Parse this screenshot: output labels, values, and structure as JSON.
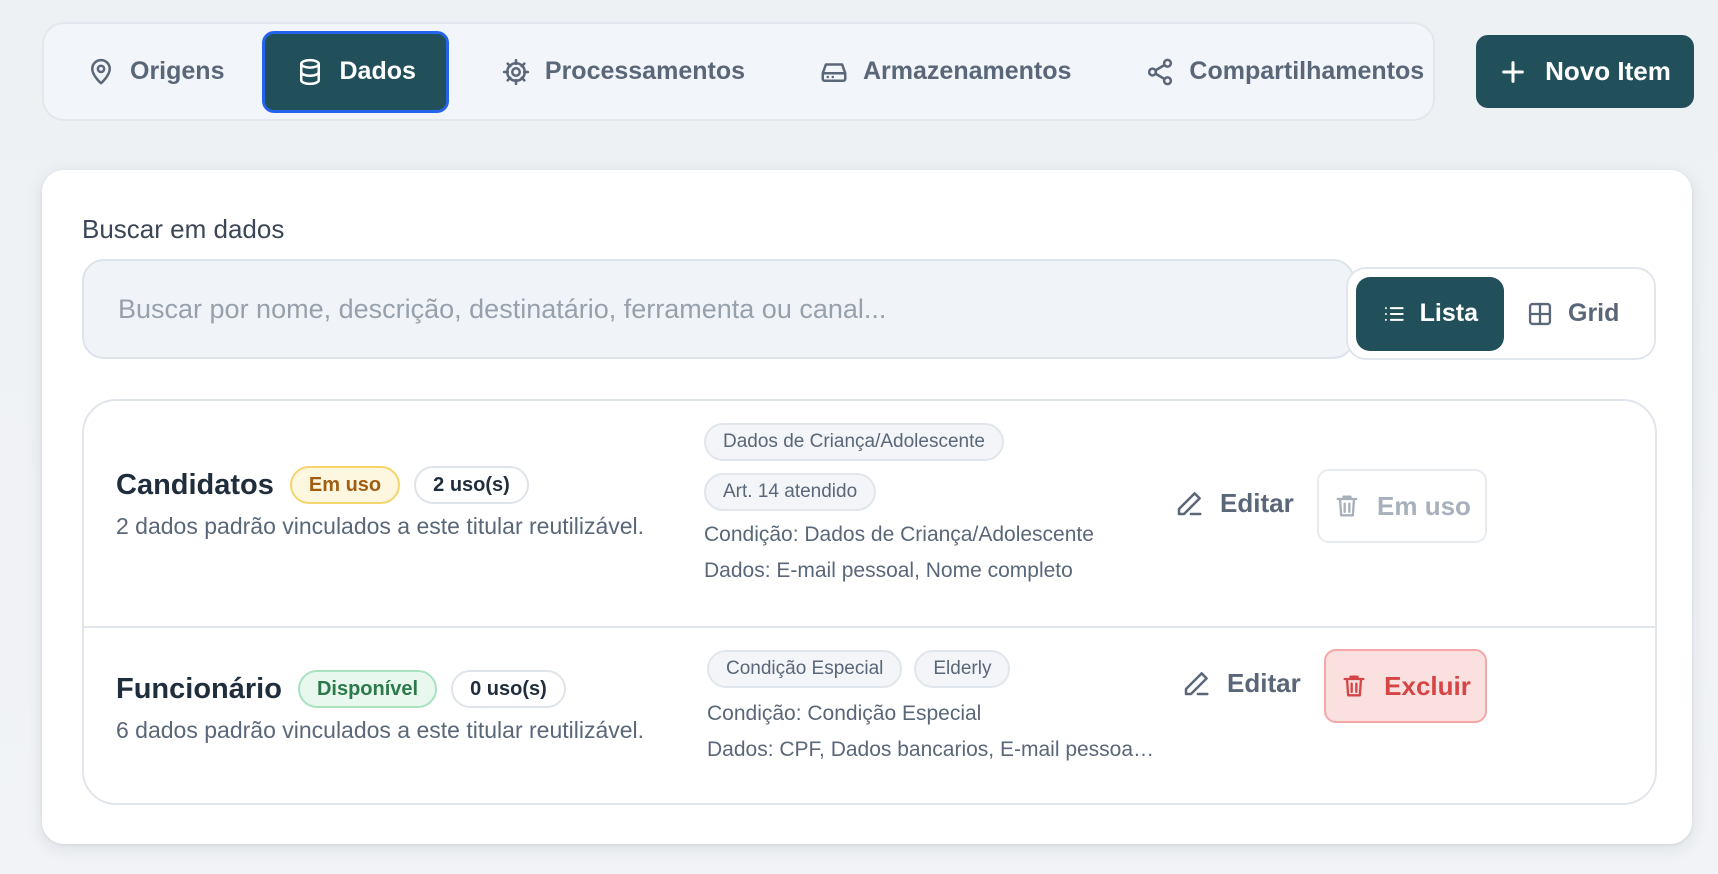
{
  "nav": {
    "tabs": [
      {
        "label": "Origens",
        "icon": "map-pin-icon",
        "active": false
      },
      {
        "label": "Dados",
        "icon": "database-icon",
        "active": true
      },
      {
        "label": "Processamentos",
        "icon": "gear-icon",
        "active": false
      },
      {
        "label": "Armazenamentos",
        "icon": "hard-drive-icon",
        "active": false
      },
      {
        "label": "Compartilhamentos",
        "icon": "share-icon",
        "active": false
      }
    ],
    "new_item_label": "Novo Item"
  },
  "search": {
    "label": "Buscar em dados",
    "placeholder": "Buscar por nome, descrição, destinatário, ferramenta ou canal...",
    "value": ""
  },
  "view_toggle": {
    "list_label": "Lista",
    "grid_label": "Grid",
    "selected": "Lista"
  },
  "items": [
    {
      "title": "Candidatos",
      "status": "Em uso",
      "usage": "2 uso(s)",
      "description": "2 dados padrão vinculados a este titular reutilizável.",
      "tags": [
        "Dados de Criança/Adolescente",
        "Art. 14 atendido"
      ],
      "condition": "Condição: Dados de Criança/Adolescente",
      "data": "Dados: E-mail pessoal, Nome completo",
      "edit_label": "Editar",
      "delete_label": "Em uso",
      "delete_enabled": false
    },
    {
      "title": "Funcionário",
      "status": "Disponível",
      "usage": "0 uso(s)",
      "description": "6 dados padrão vinculados a este titular reutilizável.",
      "tags": [
        "Condição Especial",
        "Elderly"
      ],
      "condition": "Condição: Condição Especial",
      "data": "Dados: CPF, Dados bancarios, E-mail pessoa…",
      "edit_label": "Editar",
      "delete_label": "Excluir",
      "delete_enabled": true
    }
  ],
  "colors": {
    "primary": "#22505a",
    "focus_ring": "#2563eb",
    "danger": "#d64545",
    "badge_warning": "#a15e12",
    "badge_success": "#2c7a4b"
  }
}
